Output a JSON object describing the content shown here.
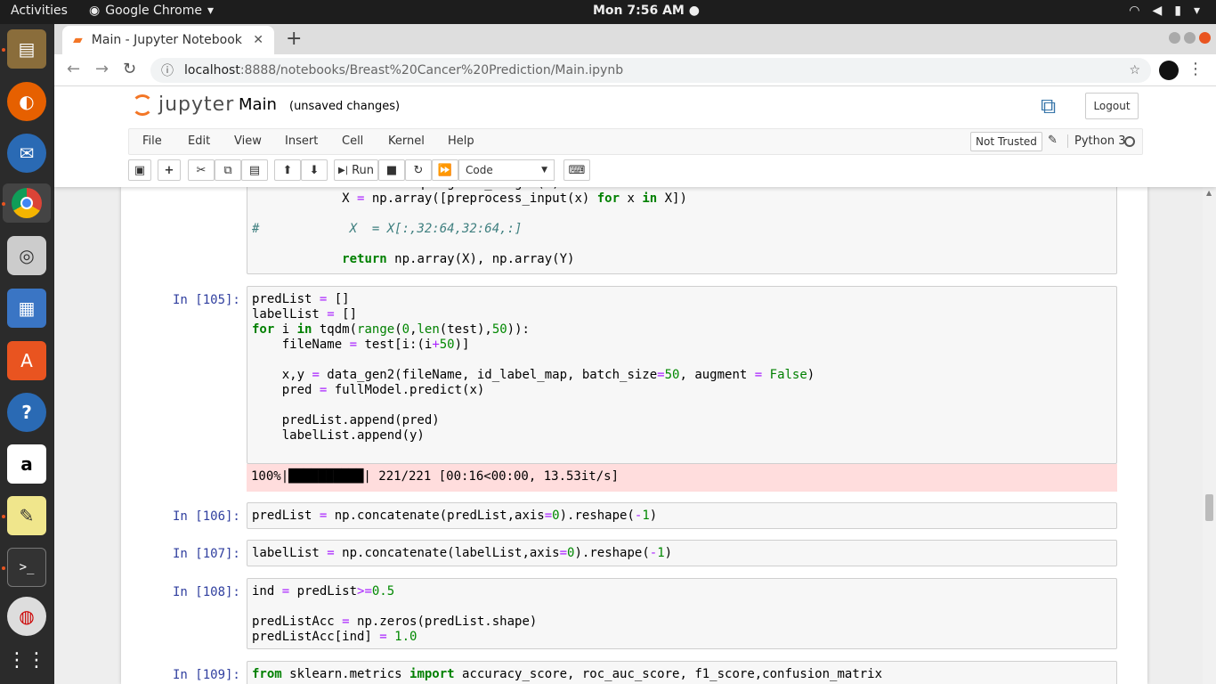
{
  "topbar": {
    "activities": "Activities",
    "app_name": "Google Chrome",
    "app_caret": "▾",
    "clock": "Mon  7:56 AM ●"
  },
  "dock": [
    "files",
    "firefox",
    "thunderbird",
    "chrome",
    "rhythmbox",
    "writer",
    "software",
    "help",
    "amazon",
    "text-editor",
    "terminal",
    "vpn",
    "apps"
  ],
  "browser": {
    "tab_title": "Main - Jupyter Notebook",
    "tab_close": "✕",
    "new_tab": "+",
    "url_host": "localhost",
    "url_path": ":8888/notebooks/Breast%20Cancer%20Prediction/Main.ipynb"
  },
  "jupyter": {
    "logo_text": "jupyter",
    "notebook_name": "Main",
    "autosave": "(unsaved changes)",
    "logout": "Logout",
    "menu": [
      "File",
      "Edit",
      "View",
      "Insert",
      "Cell",
      "Kernel",
      "Help"
    ],
    "not_trusted": "Not Trusted",
    "kernel_name": "Python 3",
    "run_label": "Run",
    "cell_type": "Code"
  },
  "cells": [
    {
      "prompt": "",
      "id": "c0"
    },
    {
      "prompt": "In [105]:",
      "id": "c1"
    },
    {
      "prompt": "In [106]:",
      "id": "c2"
    },
    {
      "prompt": "In [107]:",
      "id": "c3"
    },
    {
      "prompt": "In [108]:",
      "id": "c4"
    },
    {
      "prompt": "In [109]:",
      "id": "c5"
    }
  ],
  "outputs": {
    "progress": "100%|██████████| 221/221 [00:16<00:00, 13.53it/s]"
  }
}
